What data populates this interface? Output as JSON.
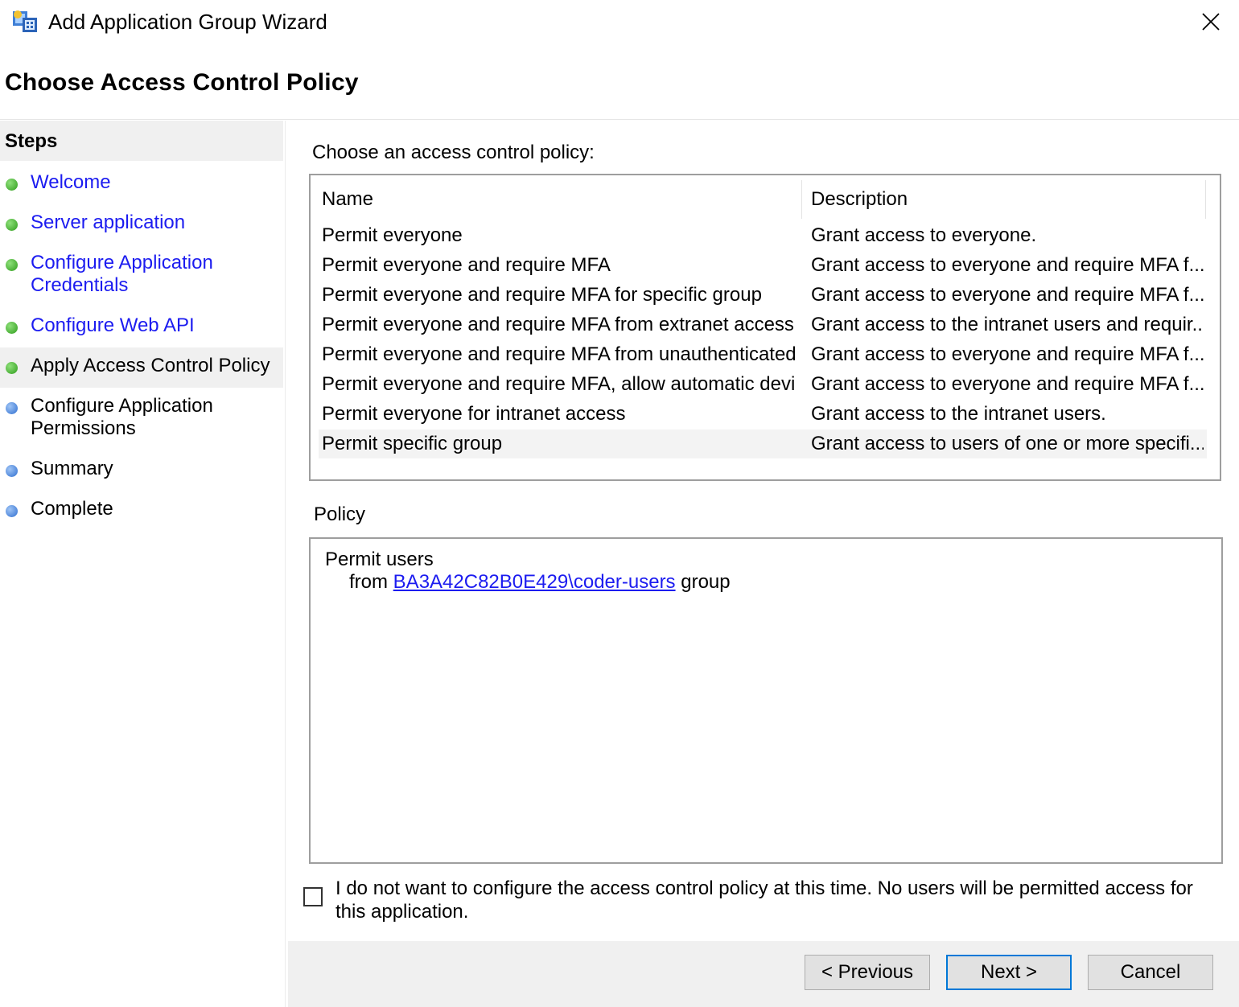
{
  "window": {
    "title": "Add Application Group Wizard",
    "app_icon": "application-group-icon",
    "close_icon": "close-icon"
  },
  "page": {
    "title": "Choose Access Control Policy"
  },
  "steps": {
    "header": "Steps",
    "items": [
      {
        "label": "Welcome",
        "status": "done"
      },
      {
        "label": "Server application",
        "status": "done"
      },
      {
        "label": "Configure Application Credentials",
        "line1": "Configure Application",
        "line2": "Credentials",
        "status": "done"
      },
      {
        "label": "Configure Web API",
        "status": "done"
      },
      {
        "label": "Apply Access Control Policy",
        "status": "current"
      },
      {
        "label": "Configure Application Permissions",
        "line1": "Configure Application",
        "line2": "Permissions",
        "status": "pending"
      },
      {
        "label": "Summary",
        "status": "pending"
      },
      {
        "label": "Complete",
        "status": "pending"
      }
    ]
  },
  "policy_list": {
    "prompt": "Choose an access control policy:",
    "columns": [
      "Name",
      "Description"
    ],
    "rows": [
      {
        "name": "Permit everyone",
        "description": "Grant access to everyone."
      },
      {
        "name": "Permit everyone and require MFA",
        "description": "Grant access to everyone and require MFA f..."
      },
      {
        "name": "Permit everyone and require MFA for specific group",
        "description": "Grant access to everyone and require MFA f..."
      },
      {
        "name": "Permit everyone and require MFA from extranet access",
        "description": "Grant access to the intranet users and requir..."
      },
      {
        "name": "Permit everyone and require MFA from unauthenticated ...",
        "description": "Grant access to everyone and require MFA f..."
      },
      {
        "name": "Permit everyone and require MFA, allow automatic devi...",
        "description": "Grant access to everyone and require MFA f..."
      },
      {
        "name": "Permit everyone for intranet access",
        "description": "Grant access to the intranet users."
      },
      {
        "name": "Permit specific group",
        "description": "Grant access to users of one or more specifi...",
        "selected": true
      }
    ]
  },
  "policy": {
    "label": "Policy",
    "line1": "Permit users",
    "from_prefix": "from",
    "group_link": "BA3A42C82B0E429\\coder-users",
    "group_suffix": "group"
  },
  "skip_checkbox": {
    "checked": false,
    "label": "I do not want to configure the access control policy at this time.  No users will be permitted access for this application."
  },
  "buttons": {
    "previous": "< Previous",
    "next": "Next >",
    "cancel": "Cancel"
  }
}
